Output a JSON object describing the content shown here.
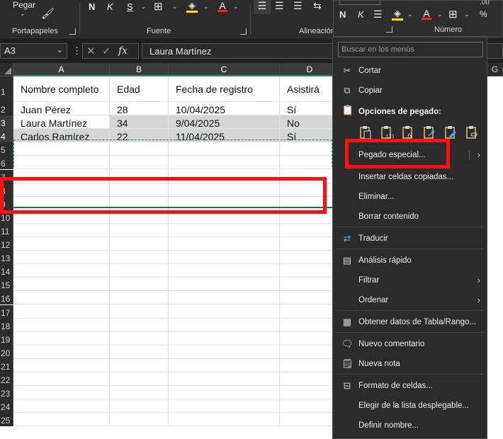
{
  "ribbon": {
    "pegar": "Pegar",
    "portapapeles": "Portapapeles",
    "fuente": "Fuente",
    "alineacion": "Alineación",
    "numero": "Número",
    "bold": "N",
    "italic": "K",
    "underline": "S",
    "mini_bold": "N",
    "mini_italic": "K",
    "percent": "%"
  },
  "formula_bar": {
    "name_box": "A3",
    "fx": "fx",
    "formula": "Laura Martínez"
  },
  "columns": [
    "A",
    "B",
    "C",
    "D",
    "G"
  ],
  "rows": [
    "1",
    "2",
    "3",
    "4",
    "5",
    "6",
    "7",
    "8",
    "9",
    "10",
    "11",
    "12",
    "13",
    "14",
    "15",
    "16",
    "17",
    "18",
    "19",
    "20",
    "21",
    "22",
    "23",
    "24",
    "25"
  ],
  "table": {
    "headers": [
      "Nombre completo",
      "Edad",
      "Fecha de registro",
      "Asistirá"
    ],
    "rows": [
      [
        "Juan Pérez",
        "28",
        "10/04/2025",
        "Sí"
      ],
      [
        "Laura Martínez",
        "34",
        "9/04/2025",
        "No"
      ],
      [
        "Carlos Ramírez",
        "22",
        "11/04/2025",
        "Sí"
      ]
    ]
  },
  "context_menu": {
    "search_placeholder": "Buscar en los menús",
    "paste_options_title": "Opciones de pegado:",
    "items": {
      "cortar": "Cortar",
      "copiar": "Copiar",
      "pegado_especial": "Pegado especial...",
      "insertar": "Insertar celdas copiadas...",
      "eliminar": "Eliminar...",
      "borrar": "Borrar contenido",
      "traducir": "Traducir",
      "analisis": "Análisis rápido",
      "filtrar": "Filtrar",
      "ordenar": "Ordenar",
      "obtener": "Obtener datos de Tabla/Rango...",
      "comentario": "Nuevo comentario",
      "nota": "Nueva nota",
      "formato": "Formato de celdas...",
      "elegir": "Elegir de la lista desplegable...",
      "definir": "Definir nombre..."
    }
  },
  "colors": {
    "highlight": "#ff1010",
    "selection_green": "#217346",
    "menu_bg": "#2b2b2b"
  }
}
